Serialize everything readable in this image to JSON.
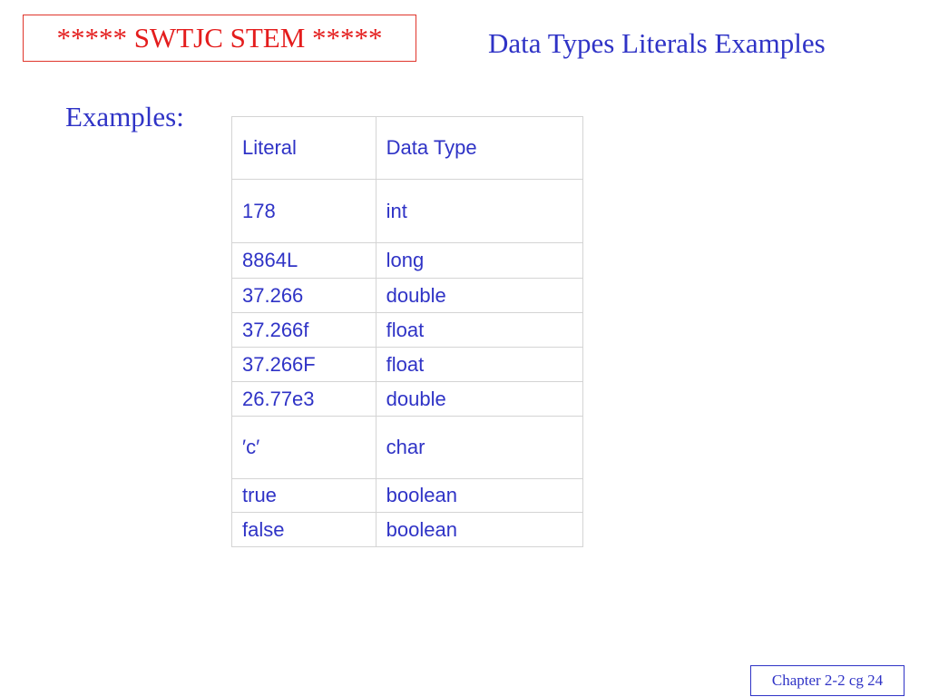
{
  "header": {
    "banner": "***** SWTJC STEM *****",
    "title": "Data Types Literals Examples"
  },
  "main": {
    "examples_label": "Examples:",
    "table": {
      "columns": [
        "Literal",
        "Data Type"
      ],
      "rows": [
        [
          "178",
          "int"
        ],
        [
          "8864L",
          "long"
        ],
        [
          "37.266",
          "double"
        ],
        [
          "37.266f",
          "float"
        ],
        [
          "37.266F",
          "float"
        ],
        [
          "26.77e3",
          "double"
        ],
        [
          "′c′",
          "char"
        ],
        [
          "true",
          "boolean"
        ],
        [
          "false",
          "boolean"
        ]
      ]
    }
  },
  "footer": {
    "chapter": "Chapter 2-2 cg 24"
  },
  "colors": {
    "text_blue": "#2f33c6",
    "banner_red": "#e41d1d",
    "table_border": "#d4d4d4"
  }
}
